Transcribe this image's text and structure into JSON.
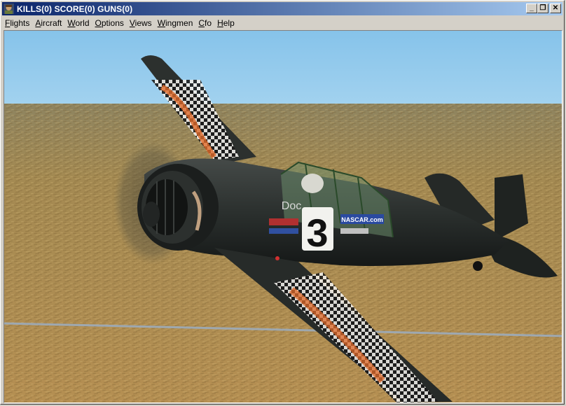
{
  "window": {
    "title": "KILLS(0) SCORE(0) GUNS(0)",
    "icon": "pilot-icon",
    "buttons": {
      "minimize": "_",
      "restore": "❐",
      "close": "✕"
    }
  },
  "menu": [
    {
      "key": "F",
      "rest": "lights",
      "name": "menu-flights"
    },
    {
      "key": "A",
      "rest": "ircraft",
      "name": "menu-aircraft"
    },
    {
      "key": "W",
      "rest": "orld",
      "name": "menu-world"
    },
    {
      "key": "O",
      "rest": "ptions",
      "name": "menu-options"
    },
    {
      "key": "V",
      "rest": "iews",
      "name": "menu-views"
    },
    {
      "key": "W",
      "rest": "ingmen",
      "name": "menu-wingmen"
    },
    {
      "key": "C",
      "rest": "fo",
      "name": "menu-cfo"
    },
    {
      "key": "H",
      "rest": "elp",
      "name": "menu-help"
    }
  ],
  "scene": {
    "sky_color": "#8cc6ea",
    "ground_color": "#a68850",
    "aircraft_color": "#2a2e2c",
    "fuselage_number": "3",
    "fuselage_text": "Doc",
    "decal_text": "NASCAR.com"
  }
}
